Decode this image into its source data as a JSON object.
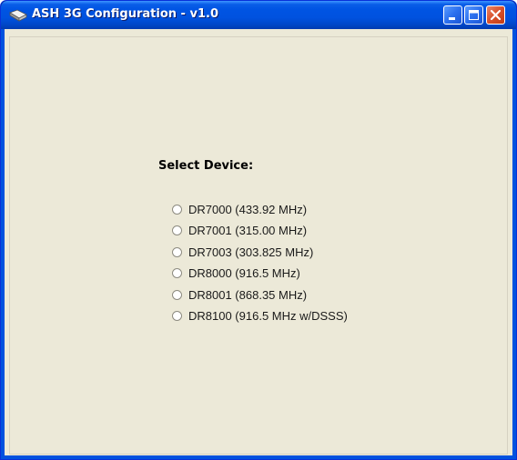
{
  "window": {
    "title": "ASH 3G Configuration - v1.0"
  },
  "content": {
    "select_label": "Select Device:",
    "devices": [
      {
        "label": "DR7000 (433.92 MHz)",
        "selected": false
      },
      {
        "label": "DR7001 (315.00 MHz)",
        "selected": false
      },
      {
        "label": "DR7003 (303.825 MHz)",
        "selected": false
      },
      {
        "label": "DR8000 (916.5 MHz)",
        "selected": false
      },
      {
        "label": "DR8001 (868.35 MHz)",
        "selected": false
      },
      {
        "label": "DR8100 (916.5 MHz w/DSSS)",
        "selected": false
      }
    ]
  },
  "icons": {
    "app": "app-icon",
    "minimize": "minimize-icon",
    "maximize": "maximize-icon",
    "close": "close-icon"
  },
  "colors": {
    "titlebar": "#0054e3",
    "client_background": "#ece9d8",
    "close_button": "#d8502a"
  }
}
